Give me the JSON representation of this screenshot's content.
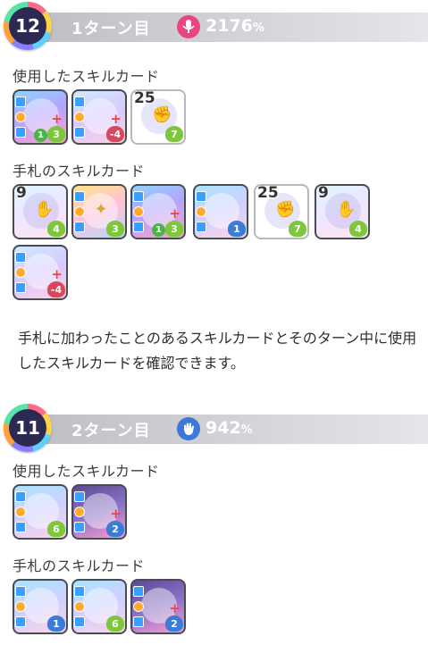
{
  "turns": [
    {
      "badge_number": "12",
      "label": "1ターン目",
      "score_value": "2176",
      "score_unit": "%",
      "score_icon": "microphone-icon",
      "score_icon_color": "#e8467f",
      "used_label": "使用したスキルカード",
      "hand_label": "手札のスキルカード",
      "used_cards": [
        {
          "art": "photo",
          "cost": "",
          "plus": "+",
          "badge": "1",
          "heart": "3",
          "heart_color": "green"
        },
        {
          "art": "wings",
          "cost": "",
          "plus": "+",
          "badge": "",
          "heart": "-4",
          "heart_color": "red"
        },
        {
          "art": "fist",
          "cost": "25",
          "plus": "",
          "badge": "",
          "heart": "7",
          "heart_color": "green"
        }
      ],
      "hand_cards": [
        {
          "art": "pale",
          "cost": "9",
          "plus": "",
          "badge": "",
          "heart": "4",
          "heart_color": "green"
        },
        {
          "art": "gold",
          "cost": "",
          "plus": "",
          "badge": "",
          "heart": "3",
          "heart_color": "green"
        },
        {
          "art": "photo",
          "cost": "",
          "plus": "+",
          "badge": "1",
          "heart": "3",
          "heart_color": "green"
        },
        {
          "art": "arch",
          "cost": "",
          "plus": "",
          "badge": "",
          "heart": "1",
          "heart_color": "blue"
        },
        {
          "art": "fist",
          "cost": "25",
          "plus": "",
          "badge": "",
          "heart": "7",
          "heart_color": "green"
        },
        {
          "art": "pale",
          "cost": "9",
          "plus": "",
          "badge": "",
          "heart": "4",
          "heart_color": "green"
        },
        {
          "art": "wings",
          "cost": "",
          "plus": "+",
          "badge": "",
          "heart": "-4",
          "heart_color": "red"
        }
      ]
    },
    {
      "badge_number": "11",
      "label": "2ターン目",
      "score_value": "942",
      "score_unit": "%",
      "score_icon": "hand-icon",
      "score_icon_color": "#3b78d8",
      "used_label": "使用したスキルカード",
      "hand_label": "手札のスキルカード",
      "used_cards": [
        {
          "art": "arch",
          "cost": "",
          "plus": "",
          "badge": "",
          "heart": "6",
          "heart_color": "green"
        },
        {
          "art": "stage",
          "cost": "",
          "plus": "+",
          "badge": "",
          "heart": "2",
          "heart_color": "blue"
        }
      ],
      "hand_cards": [
        {
          "art": "arch",
          "cost": "",
          "plus": "",
          "badge": "",
          "heart": "1",
          "heart_color": "blue"
        },
        {
          "art": "arch",
          "cost": "",
          "plus": "",
          "badge": "",
          "heart": "6",
          "heart_color": "green"
        },
        {
          "art": "stage",
          "cost": "",
          "plus": "+",
          "badge": "",
          "heart": "2",
          "heart_color": "blue"
        }
      ]
    }
  ],
  "description": "手札に加わったことのあるスキルカードとそのターン中に使用したスキルカードを確認できます。"
}
